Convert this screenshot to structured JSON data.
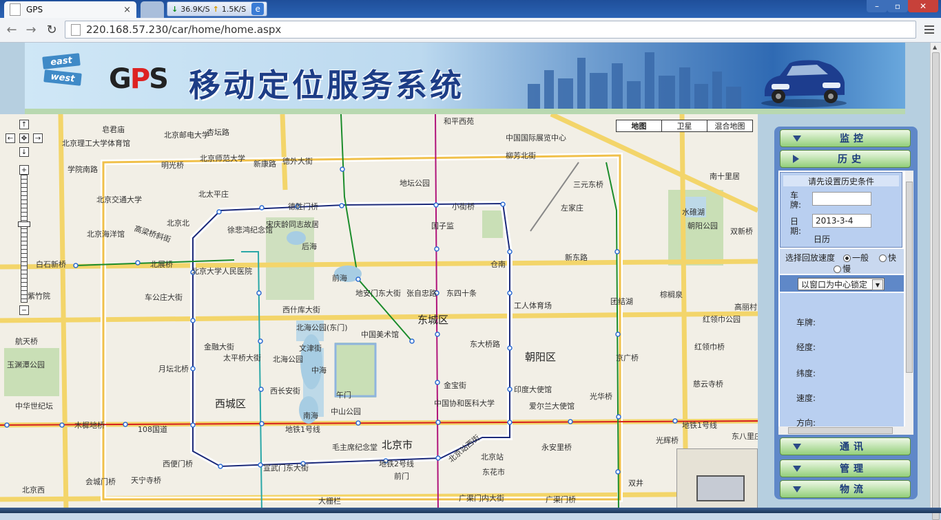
{
  "browser": {
    "tab_title": "GPS",
    "tab_close": "×",
    "download_speed": "36.9K/S",
    "upload_speed": "1.5K/S",
    "url": "220.168.57.230/car/home/home.aspx"
  },
  "banner": {
    "sign_east": "east",
    "sign_west": "west",
    "logo_g": "G",
    "logo_p": "P",
    "logo_s": "S",
    "title": "移动定位服务系统"
  },
  "map": {
    "types": [
      {
        "label": "地图",
        "active": true
      },
      {
        "label": "卫星",
        "active": false
      },
      {
        "label": "混合地图",
        "active": false
      }
    ],
    "districts": [
      "东城区",
      "西城区",
      "朝阳区",
      "北京市"
    ],
    "labels": [
      "北京理工大学体育馆",
      "皂君庙",
      "北京邮电大学",
      "杏坛路",
      "和平西苑",
      "中国国际展览中心",
      "柳芳北街",
      "三元东桥",
      "南十里居",
      "学院南路",
      "明光桥",
      "北京师范大学",
      "新康路",
      "德外大街",
      "地坛公园",
      "北太平庄",
      "北京交通大学",
      "德胜门桥",
      "小街桥",
      "左家庄",
      "国子监",
      "宋庆龄同志故居",
      "北京北",
      "高梁桥斜街",
      "徐悲鸿纪念馆",
      "北京海洋馆",
      "双新桥",
      "白石新桥",
      "北展桥",
      "后海",
      "水碓湖",
      "朝阳公园",
      "北京大学人民医院",
      "前海",
      "地安门东大街",
      "张自忠路",
      "东四十条",
      "新东路",
      "仓南",
      "工人体育场",
      "团结湖",
      "棕榈泉",
      "高丽村",
      "车公庄大街",
      "紫竹院",
      "西什库大街",
      "北海公园(东门)",
      "中国美术馆",
      "红领巾公园",
      "航天桥",
      "文津街",
      "红领巾桥",
      "玉渊潭公园",
      "北海公园",
      "中海",
      "东大桥路",
      "京广桥",
      "月坛北桥",
      "金融大街",
      "太平桥大街",
      "西长安街",
      "午门",
      "中国协和医科大学",
      "金宝街",
      "印度大使馆",
      "光华桥",
      "慈云寺桥",
      "中华世纪坛",
      "西城",
      "中山公园",
      "南海",
      "爱尔兰大使馆",
      "木樨地桥",
      "108国道",
      "地铁1号线",
      "地铁1号线",
      "东八里庄",
      "毛主席纪念堂",
      "北京站西街",
      "北京站",
      "永安里桥",
      "光辉桥",
      "西便门桥",
      "宣武门东大街",
      "地铁2号线",
      "前门",
      "东花市",
      "会城门桥",
      "天宁寺桥",
      "广渠门内大街",
      "广渠门桥",
      "双井",
      "大栅栏",
      "北京西"
    ]
  },
  "panel": {
    "monitor_label": "监控",
    "history_label": "历史",
    "comm_label": "通讯",
    "manage_label": "管理",
    "logistics_label": "物流",
    "cond_title": "请先设置历史条件",
    "plate_label": "车牌:",
    "plate_value": "",
    "date_label": "日期:",
    "date_value": "2013-3-4",
    "calendar_link": "日历",
    "speed_label": "选择回放速度",
    "speed_options": [
      "一般",
      "快",
      "慢"
    ],
    "speed_selected": "一般",
    "lock_option": "以窗口为中心锁定",
    "info_plate": "车牌:",
    "info_lng": "经度:",
    "info_lat": "纬度:",
    "info_speed": "速度:",
    "info_dir": "方向:"
  }
}
